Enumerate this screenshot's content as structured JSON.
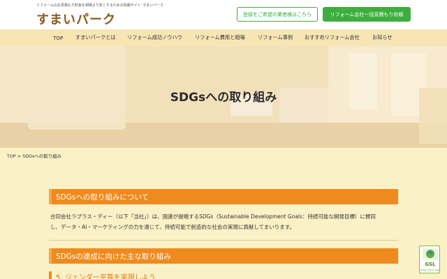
{
  "header": {
    "tagline": "リフォームのお見積もり料金を相場より安くするための情報サイト･すまいパーク",
    "logo": "すまいパーク",
    "register_button": "登録をご希望の業者様はこちら",
    "quote_button": "リフォーム会社一括見積もり依頼"
  },
  "nav": {
    "items": [
      "TOP",
      "すまいパークとは",
      "リフォーム成功ノウハウ",
      "リフォーム費用と相場",
      "リフォーム事例",
      "おすすめリフォーム会社",
      "お知らせ"
    ]
  },
  "hero": {
    "title": "SDGsへの取り組み"
  },
  "breadcrumb": {
    "home": "TOP",
    "separator": ">",
    "current": "SDGsへの取り組み"
  },
  "sections": {
    "about": {
      "heading": "SDGsへの取り組みについて",
      "line1": "合同会社ラプラス・ディー（以下「当社」）は、国連が提唱するSDGs（Sustainable Development Goals：持続可能な開発目標）に賛同",
      "line2": "し、データ・AI・マーケティングの力を通じて、持続可能で創造的な社会の実現に貢献してまいります。"
    },
    "main_efforts": {
      "heading": "SDGsの達成に向けた主な取り組み",
      "sub_heading": "5. ジェンダー平等を実現しよう"
    }
  },
  "badge": {
    "label": "GSL",
    "sub": "Green Site License"
  },
  "colors": {
    "accent": "#ef8a1e",
    "green": "#3dae3d",
    "nav_bg": "#f7e6b4",
    "page_bg": "#fbf1c6"
  }
}
